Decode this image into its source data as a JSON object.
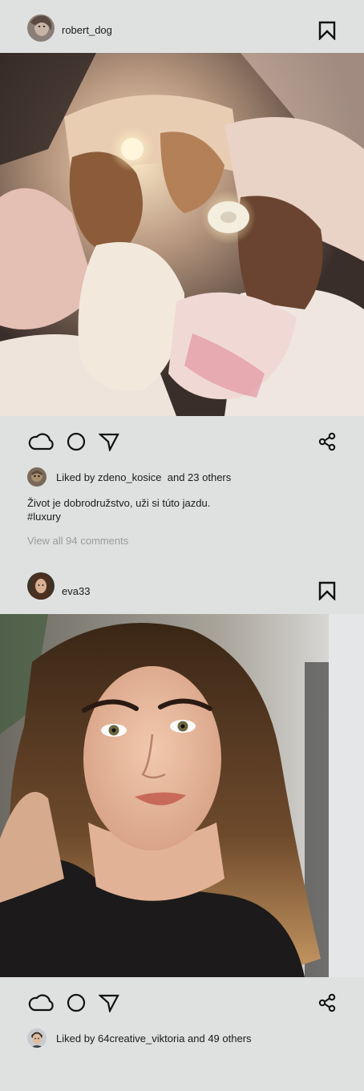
{
  "posts": [
    {
      "username": "robert_dog",
      "avatar_icon": "user-avatar",
      "image_desc": "three-girls-on-bed-photo",
      "actions": [
        "cloud-icon",
        "circle-icon",
        "send-icon",
        "share-icon"
      ],
      "likes_text": "Liked by zdeno_kosice  and 23 others",
      "caption": "Život je dobrodružstvo, uži si túto jazdu.",
      "hashtag": "#luxury",
      "comments_link": "View all 94 comments"
    },
    {
      "username": "eva33",
      "avatar_icon": "user-avatar",
      "image_desc": "woman-portrait-photo",
      "actions": [
        "cloud-icon",
        "circle-icon",
        "send-icon",
        "share-icon"
      ],
      "likes_text": "Liked by 64creative_viktoria and 49 others"
    }
  ],
  "colors": {
    "background": "#dfe1e0",
    "text": "#1a1a1a",
    "muted": "#9a9a9a"
  }
}
